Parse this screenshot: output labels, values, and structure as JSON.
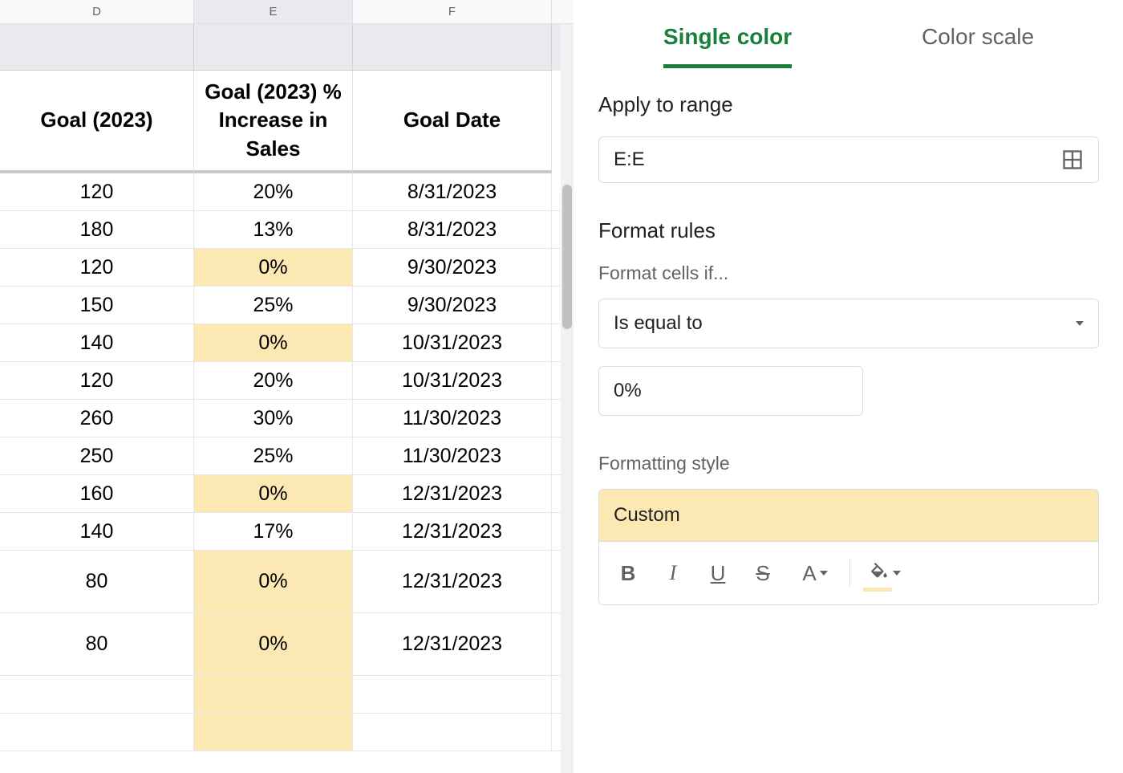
{
  "columns": {
    "d": {
      "letter": "D",
      "header": "Goal (2023)"
    },
    "e": {
      "letter": "E",
      "header": "Goal (2023) % Increase in Sales"
    },
    "f": {
      "letter": "F",
      "header": "Goal Date"
    }
  },
  "rows": [
    {
      "d": "120",
      "e": "20%",
      "f": "8/31/2023",
      "highlight": false,
      "tall": false
    },
    {
      "d": "180",
      "e": "13%",
      "f": "8/31/2023",
      "highlight": false,
      "tall": false
    },
    {
      "d": "120",
      "e": "0%",
      "f": "9/30/2023",
      "highlight": true,
      "tall": false
    },
    {
      "d": "150",
      "e": "25%",
      "f": "9/30/2023",
      "highlight": false,
      "tall": false
    },
    {
      "d": "140",
      "e": "0%",
      "f": "10/31/2023",
      "highlight": true,
      "tall": false
    },
    {
      "d": "120",
      "e": "20%",
      "f": "10/31/2023",
      "highlight": false,
      "tall": false
    },
    {
      "d": "260",
      "e": "30%",
      "f": "11/30/2023",
      "highlight": false,
      "tall": false
    },
    {
      "d": "250",
      "e": "25%",
      "f": "11/30/2023",
      "highlight": false,
      "tall": false
    },
    {
      "d": "160",
      "e": "0%",
      "f": "12/31/2023",
      "highlight": true,
      "tall": false
    },
    {
      "d": "140",
      "e": "17%",
      "f": "12/31/2023",
      "highlight": false,
      "tall": false
    },
    {
      "d": "80",
      "e": "0%",
      "f": "12/31/2023",
      "highlight": true,
      "tall": true
    },
    {
      "d": "80",
      "e": "0%",
      "f": "12/31/2023",
      "highlight": true,
      "tall": true
    }
  ],
  "sidebar": {
    "tabs": {
      "single_color": "Single color",
      "color_scale": "Color scale"
    },
    "apply_range": {
      "label": "Apply to range",
      "value": "E:E"
    },
    "format_rules": {
      "label": "Format rules",
      "cells_if_label": "Format cells if...",
      "condition": "Is equal to",
      "value": "0%"
    },
    "formatting_style": {
      "label": "Formatting style",
      "preview": "Custom"
    }
  }
}
